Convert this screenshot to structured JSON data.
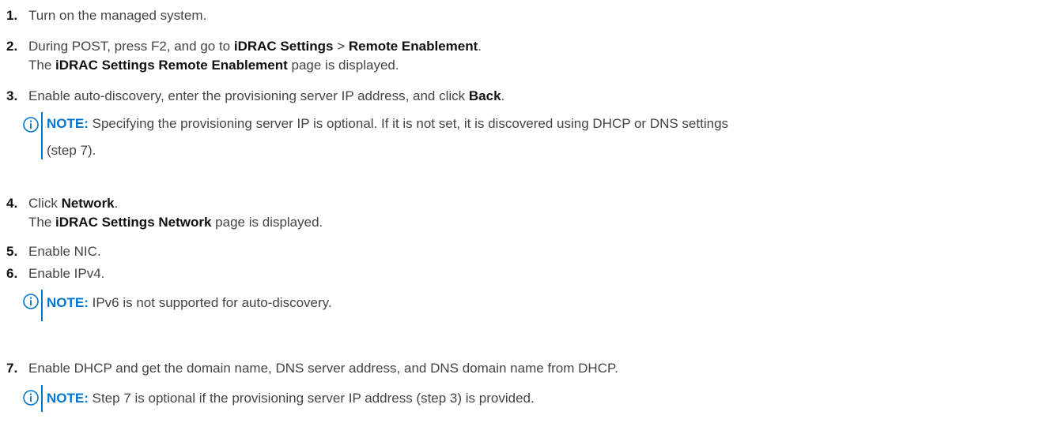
{
  "accent_color": "#0076ce",
  "steps": [
    {
      "num": "1.",
      "text": "Turn on the managed system."
    },
    {
      "num": "2.",
      "pre": "During POST, press F2, and go to ",
      "b1": "iDRAC Settings",
      "mid": " > ",
      "b2": "Remote Enablement",
      "post": ".",
      "line2_pre": "The ",
      "line2_b": "iDRAC Settings Remote Enablement",
      "line2_post": " page is displayed."
    },
    {
      "num": "3.",
      "pre": "Enable auto-discovery, enter the provisioning server IP address, and click ",
      "b1": "Back",
      "post": "."
    },
    {
      "num": "4.",
      "pre": "Click ",
      "b1": "Network",
      "post": ".",
      "line2_pre": "The ",
      "line2_b": "iDRAC Settings Network",
      "line2_post": " page is displayed."
    },
    {
      "num": "5.",
      "text": "Enable NIC."
    },
    {
      "num": "6.",
      "text": "Enable IPv4."
    },
    {
      "num": "7.",
      "text": "Enable DHCP and get the domain name, DNS server address, and DNS domain name from DHCP."
    }
  ],
  "notes": [
    {
      "icon": "info-icon",
      "label": "NOTE:",
      "line1": " Specifying the provisioning server IP is optional. If it is not set, it is discovered using DHCP or DNS settings",
      "line2": "(step 7)."
    },
    {
      "icon": "info-icon",
      "label": "NOTE:",
      "line1": " IPv6 is not supported for auto-discovery."
    },
    {
      "icon": "info-icon",
      "label": "NOTE:",
      "line1": " Step 7 is optional if the provisioning server IP address (step 3) is provided."
    }
  ]
}
